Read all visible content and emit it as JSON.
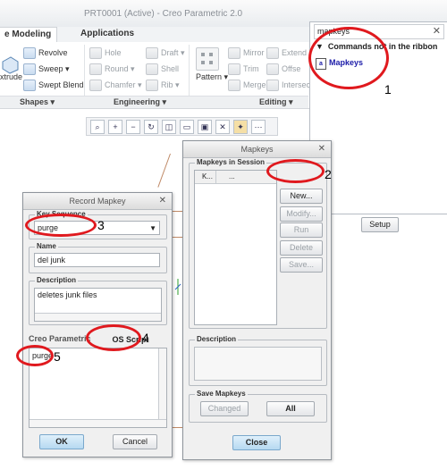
{
  "window": {
    "title": "PRT0001 (Active) - Creo Parametric 2.0"
  },
  "tabs": [
    {
      "label": "e Modeling"
    },
    {
      "label": "Applications"
    }
  ],
  "ribbon": {
    "shapes": {
      "extrude": "xtrude",
      "revolve": "Revolve",
      "sweep": "Sweep",
      "swept_blend": "Swept Blend"
    },
    "engineering": {
      "hole": "Hole",
      "round": "Round",
      "chamfer": "Chamfer",
      "draft": "Draft",
      "shell": "Shell",
      "rib": "Rib"
    },
    "editing": {
      "pattern": "Pattern",
      "mirror": "Mirror",
      "trim": "Trim",
      "merge": "Merge",
      "extend": "Extend",
      "offset": "Offse",
      "intersect": "Intersect"
    },
    "groups": {
      "shapes": "Shapes",
      "engineering": "Engineering",
      "editing": "Editing"
    }
  },
  "search": {
    "query": "mapkeys",
    "section": "Commands not in the ribbon",
    "result": "Mapkeys",
    "setup_button": "Setup"
  },
  "mapkeys_dialog": {
    "title": "Mapkeys",
    "list_legend": "Mapkeys in Session",
    "col_key": "K...",
    "col_name": "...",
    "buttons": {
      "new": "New...",
      "modify": "Modify...",
      "run": "Run",
      "delete": "Delete",
      "save": "Save..."
    },
    "description_legend": "Description",
    "save_legend": "Save Mapkeys",
    "changed": "Changed",
    "all": "All",
    "close": "Close"
  },
  "record_dialog": {
    "title": "Record Mapkey",
    "key_legend": "Key Sequence",
    "key_value": "purge",
    "name_legend": "Name",
    "name_value": "del junk",
    "desc_legend": "Description",
    "desc_value": "deletes junk files",
    "tab_creo": "Creo Parametric",
    "tab_os": "OS Script",
    "script": "purge",
    "ok": "OK",
    "cancel": "Cancel"
  },
  "annotations": {
    "n1": "1",
    "n2": "2",
    "n3": "3",
    "n4": "4",
    "n5": "5"
  },
  "colors": {
    "annotation_red": "#e0191e",
    "link_blue": "#1b1ba8"
  }
}
